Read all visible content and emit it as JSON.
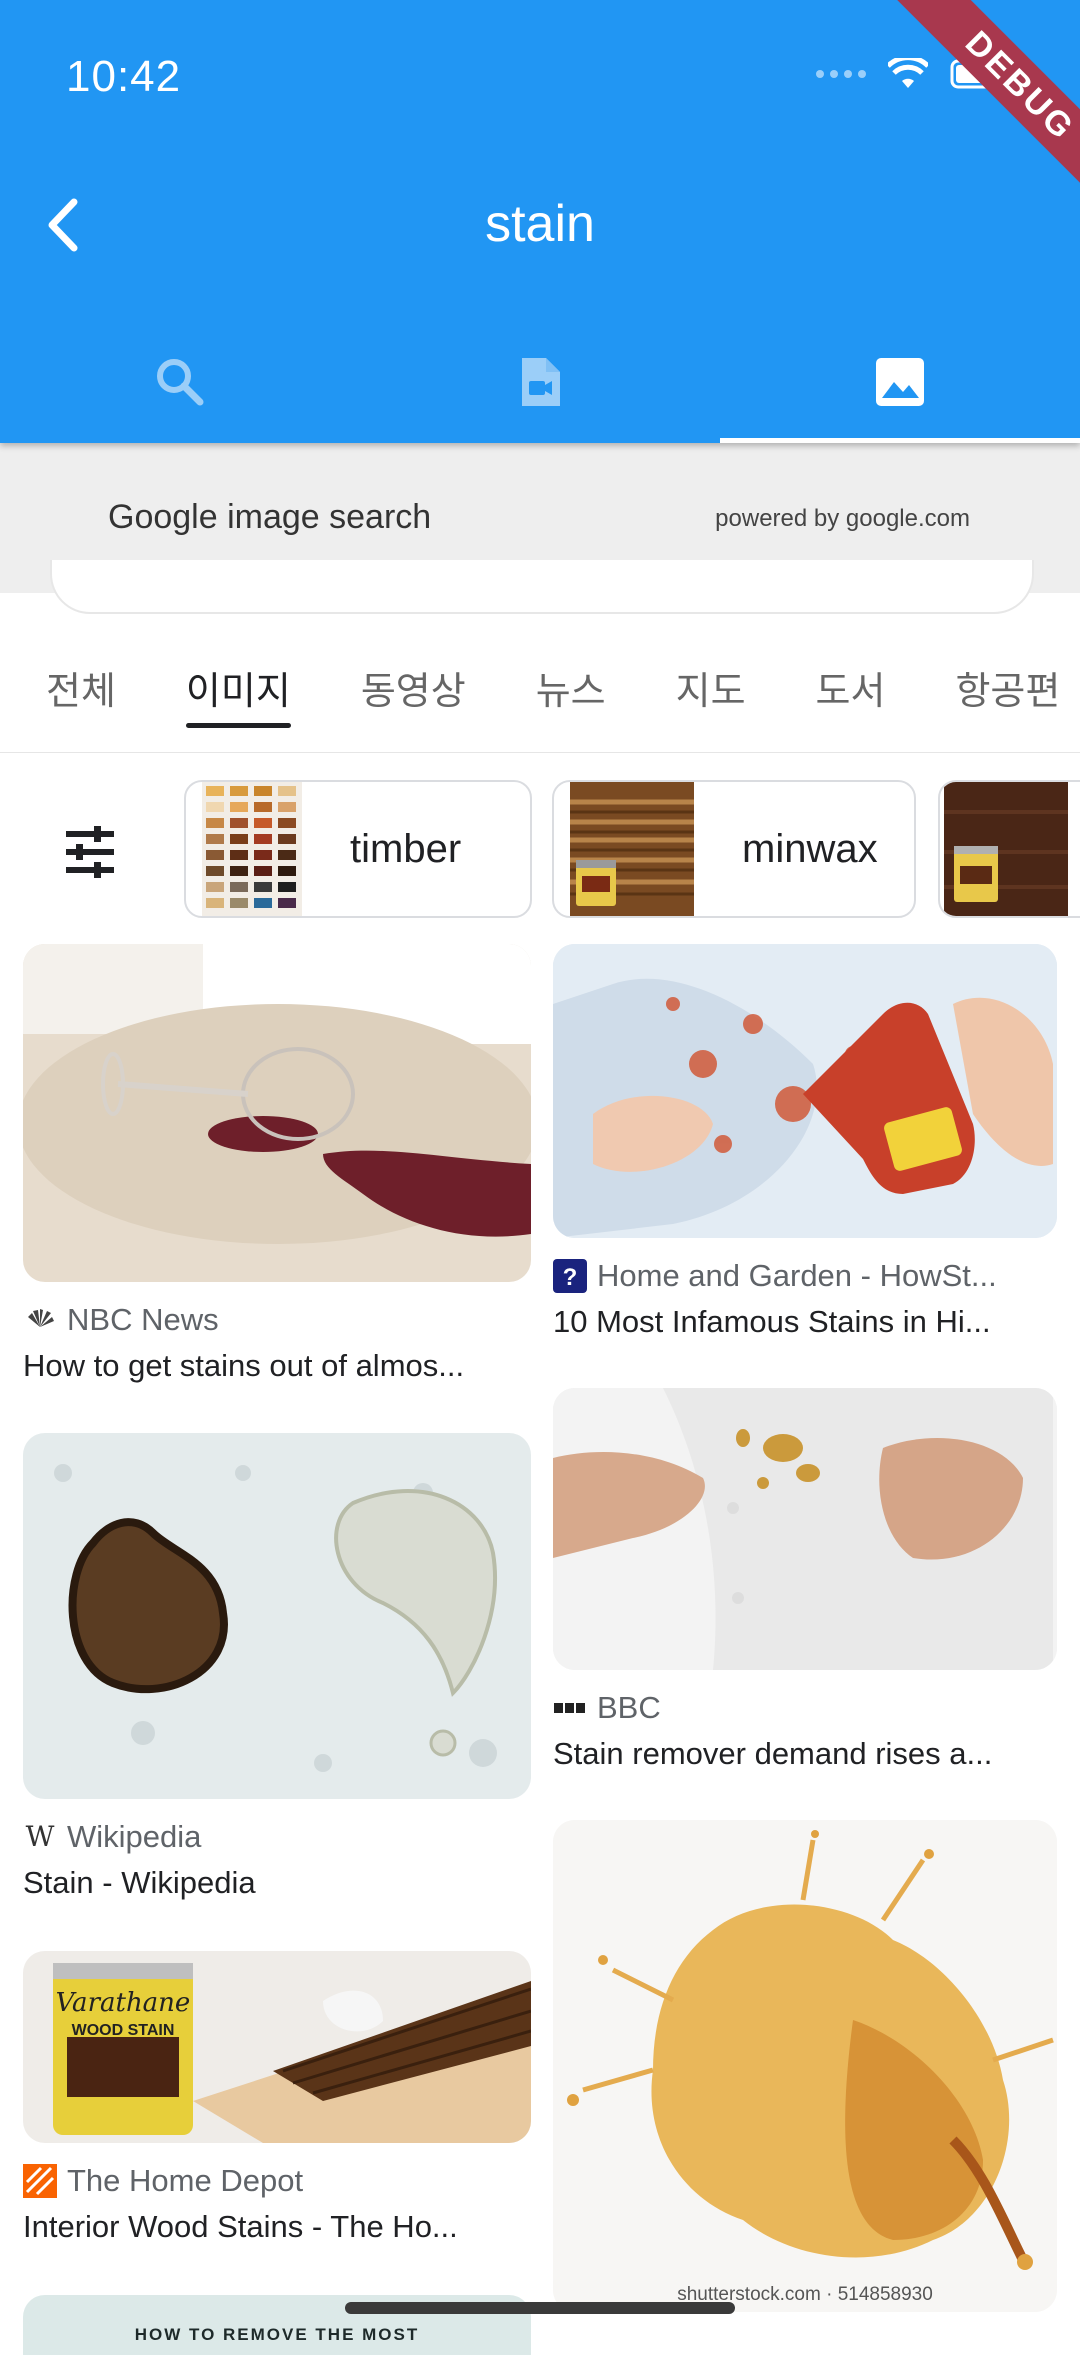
{
  "status_bar": {
    "time": "10:42",
    "debug_label": "DEBUG"
  },
  "app_bar": {
    "title": "stain"
  },
  "tabs": [
    {
      "icon": "search-icon",
      "active": false
    },
    {
      "icon": "video-file-icon",
      "active": false
    },
    {
      "icon": "image-icon",
      "active": true
    }
  ],
  "google_strip": {
    "title": "Google image search",
    "powered": "powered by google.com"
  },
  "category_tabs": [
    "전체",
    "이미지",
    "동영상",
    "뉴스",
    "지도",
    "도서",
    "항공편"
  ],
  "active_category_index": 1,
  "chips": [
    {
      "label": "timber",
      "thumb": "color-swatch-thumbnail"
    },
    {
      "label": "minwax",
      "thumb": "wood-stain-can-thumbnail"
    },
    {
      "label": "",
      "thumb": "wood-stain-can-thumbnail"
    }
  ],
  "results_left": [
    {
      "source": "NBC News",
      "title": "How to get stains out of almos...",
      "image": "wine-spill-on-carpet"
    },
    {
      "source": "Wikipedia",
      "title": "Stain - Wikipedia",
      "image": "stain-on-stone"
    },
    {
      "source": "The Home Depot",
      "title": "Interior Wood Stains - The Ho...",
      "image": "varathane-wood-stain"
    },
    {
      "source": "",
      "title": "",
      "image": "how-to-remove-banner",
      "banner_text": "HOW TO REMOVE THE MOST"
    }
  ],
  "results_right": [
    {
      "source": "Home and Garden - HowSt...",
      "title": "10 Most Infamous Stains in Hi...",
      "image": "ketchup-on-shirt"
    },
    {
      "source": "BBC",
      "title": "Stain remover demand rises a...",
      "image": "stain-on-white-shirt"
    },
    {
      "source": "",
      "title": "",
      "image": "orange-splash",
      "watermark": "shutterstock.com · 514858930"
    }
  ],
  "colors": {
    "primary": "#2196F3",
    "ribbon": "#a8384e",
    "text": "#202124",
    "secondary_text": "#5f6368"
  }
}
